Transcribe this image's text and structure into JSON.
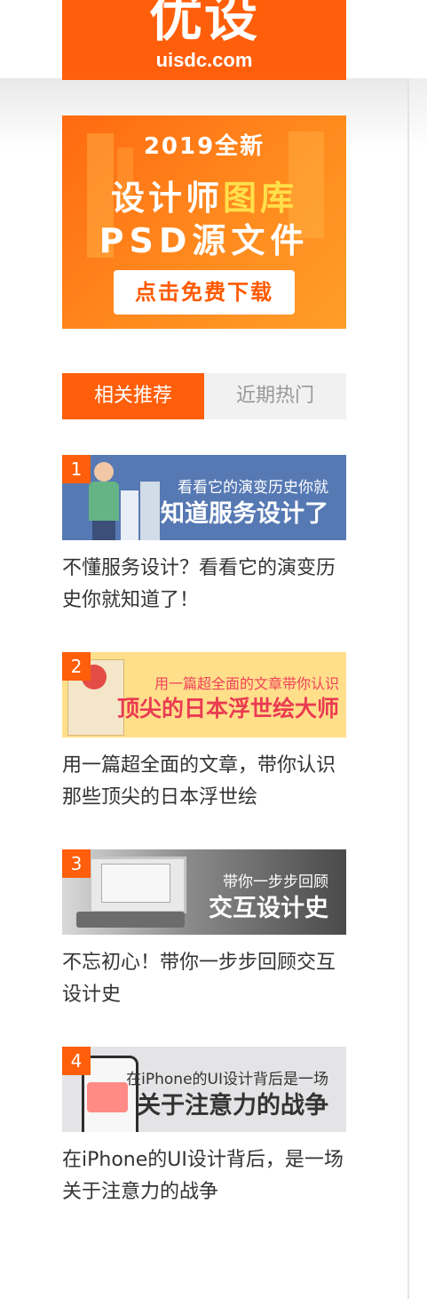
{
  "logo": {
    "text": "优设",
    "domain": "uisdc.com"
  },
  "ad": {
    "line1": "2019全新",
    "line2_prefix": "设计师",
    "line2_highlight": "图库",
    "line3": "PSD源文件",
    "cta": "点击免费下载"
  },
  "tabs": [
    {
      "label": "相关推荐",
      "active": true
    },
    {
      "label": "近期热门",
      "active": false
    }
  ],
  "articles": [
    {
      "rank": "1",
      "thumb_small": "看看它的演变历史你就",
      "thumb_big": "知道服务设计了",
      "title": "不懂服务设计？看看它的演变历史你就知道了！"
    },
    {
      "rank": "2",
      "thumb_small": "用一篇超全面的文章带你认识",
      "thumb_big": "顶尖的日本浮世绘大师",
      "title": "用一篇超全面的文章，带你认识那些顶尖的日本浮世绘"
    },
    {
      "rank": "3",
      "thumb_small": "带你一步步回顾",
      "thumb_big": "交互设计史",
      "title": "不忘初心！带你一步步回顾交互设计史"
    },
    {
      "rank": "4",
      "thumb_small": "在iPhone的UI设计背后是一场",
      "thumb_big": "关于注意力的战争",
      "title": "在iPhone的UI设计背后，是一场关于注意力的战争"
    }
  ],
  "colors": {
    "accent": "#ff5e0a",
    "tab_inactive_bg": "#f1f1f1",
    "title_text": "#333333"
  }
}
